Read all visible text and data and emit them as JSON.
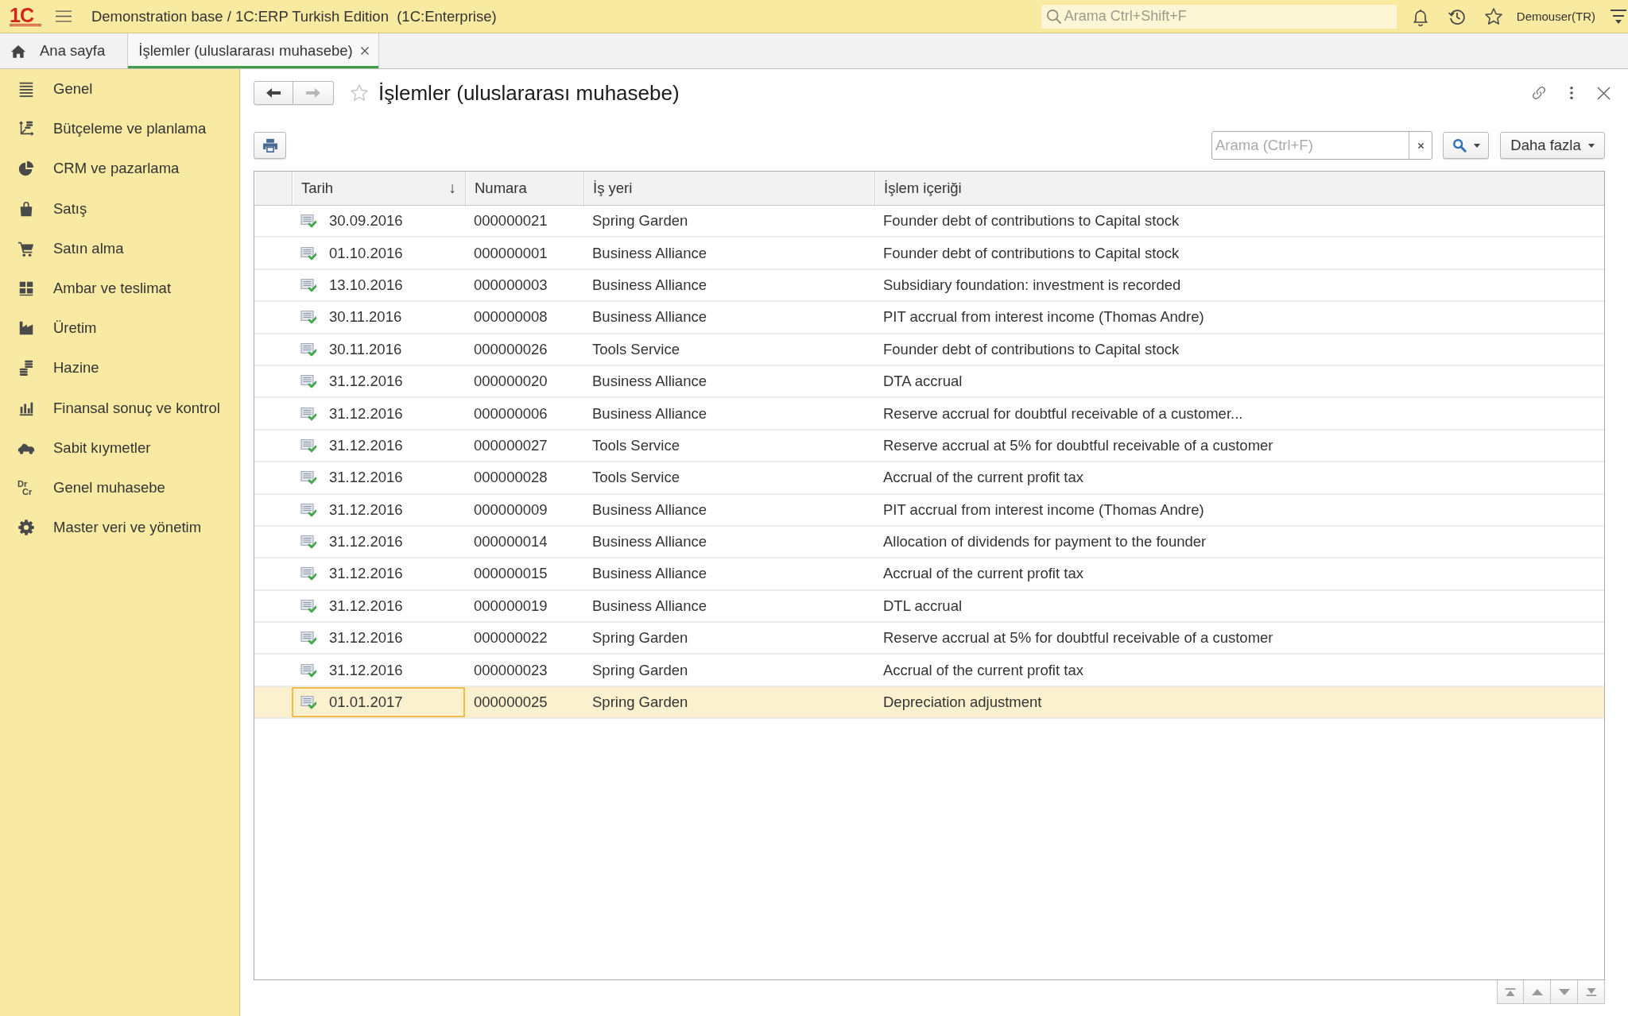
{
  "header": {
    "logo": "1C",
    "title": "Demonstration base / 1C:ERP Turkish Edition  (1C:Enterprise)",
    "search": {
      "placeholder": "Arama Ctrl+Shift+F"
    },
    "user": "Demouser(TR)"
  },
  "tabs": [
    {
      "kind": "home",
      "label": "Ana sayfa",
      "selected": false
    },
    {
      "kind": "form",
      "label": "İşlemler (uluslararası muhasebe)",
      "selected": true
    }
  ],
  "sidebar": {
    "items": [
      {
        "label": "Genel",
        "selected": false
      },
      {
        "label": "Bütçeleme ve planlama",
        "selected": false
      },
      {
        "label": "CRM ve pazarlama",
        "selected": false
      },
      {
        "label": "Satış",
        "selected": false
      },
      {
        "label": "Satın alma",
        "selected": false
      },
      {
        "label": "Ambar ve teslimat",
        "selected": false
      },
      {
        "label": "Üretim",
        "selected": false
      },
      {
        "label": "Hazine",
        "selected": false
      },
      {
        "label": "Finansal sonuç ve kontrol",
        "selected": false
      },
      {
        "label": "Sabit kıymetler",
        "selected": false
      },
      {
        "label": "Genel muhasebe",
        "selected": false,
        "icon_text": [
          "Dr",
          "Cr"
        ]
      },
      {
        "label": "Master veri ve yönetim",
        "selected": false
      }
    ]
  },
  "form": {
    "title": "İşlemler (uluslararası muhasebe)",
    "favorite": false,
    "navigation": [
      {
        "kind": "back",
        "disabled": false
      },
      {
        "kind": "forward",
        "disabled": true
      }
    ],
    "search": {
      "placeholder": "Arama (Ctrl+F)"
    },
    "more_button": "Daha fazla"
  },
  "table": {
    "columns": [
      {
        "label": "Tarih",
        "sort_mark": "↓"
      },
      {
        "label": "Numara"
      },
      {
        "label": "İş yeri"
      },
      {
        "label": "İşlem içeriği"
      }
    ],
    "rows": [
      {
        "date": "30.09.2016",
        "number": "000000021",
        "business_unit": "Spring Garden",
        "content": "Founder debt of contributions to Capital stock",
        "posted": true,
        "selected": false
      },
      {
        "date": "01.10.2016",
        "number": "000000001",
        "business_unit": "Business Alliance",
        "content": "Founder debt of contributions to Capital stock",
        "posted": true,
        "selected": false
      },
      {
        "date": "13.10.2016",
        "number": "000000003",
        "business_unit": "Business Alliance",
        "content": "Subsidiary foundation: investment is recorded",
        "posted": true,
        "selected": false
      },
      {
        "date": "30.11.2016",
        "number": "000000008",
        "business_unit": "Business Alliance",
        "content": "PIT accrual from interest income (Thomas Andre)",
        "posted": true,
        "selected": false
      },
      {
        "date": "30.11.2016",
        "number": "000000026",
        "business_unit": "Tools Service",
        "content": "Founder debt of contributions to Capital stock",
        "posted": true,
        "selected": false
      },
      {
        "date": "31.12.2016",
        "number": "000000020",
        "business_unit": "Business Alliance",
        "content": "DTA accrual",
        "posted": true,
        "selected": false
      },
      {
        "date": "31.12.2016",
        "number": "000000006",
        "business_unit": "Business Alliance",
        "content": "Reserve accrual for doubtful receivable of a customer...",
        "posted": true,
        "selected": false
      },
      {
        "date": "31.12.2016",
        "number": "000000027",
        "business_unit": "Tools Service",
        "content": "Reserve accrual at 5% for doubtful receivable of a customer",
        "posted": true,
        "selected": false
      },
      {
        "date": "31.12.2016",
        "number": "000000028",
        "business_unit": "Tools Service",
        "content": "Accrual of the current profit tax",
        "posted": true,
        "selected": false
      },
      {
        "date": "31.12.2016",
        "number": "000000009",
        "business_unit": "Business Alliance",
        "content": "PIT accrual from interest income (Thomas Andre)",
        "posted": true,
        "selected": false
      },
      {
        "date": "31.12.2016",
        "number": "000000014",
        "business_unit": "Business Alliance",
        "content": "Allocation of dividends for payment to the founder",
        "posted": true,
        "selected": false
      },
      {
        "date": "31.12.2016",
        "number": "000000015",
        "business_unit": "Business Alliance",
        "content": "Accrual of the current profit tax",
        "posted": true,
        "selected": false
      },
      {
        "date": "31.12.2016",
        "number": "000000019",
        "business_unit": "Business Alliance",
        "content": "DTL accrual",
        "posted": true,
        "selected": false
      },
      {
        "date": "31.12.2016",
        "number": "000000022",
        "business_unit": "Spring Garden",
        "content": "Reserve accrual at 5% for doubtful receivable of a customer",
        "posted": true,
        "selected": false
      },
      {
        "date": "31.12.2016",
        "number": "000000023",
        "business_unit": "Spring Garden",
        "content": "Accrual of the current profit tax",
        "posted": true,
        "selected": false
      },
      {
        "date": "01.01.2017",
        "number": "000000025",
        "business_unit": "Spring Garden",
        "content": "Depreciation adjustment",
        "posted": true,
        "selected": true
      }
    ]
  }
}
